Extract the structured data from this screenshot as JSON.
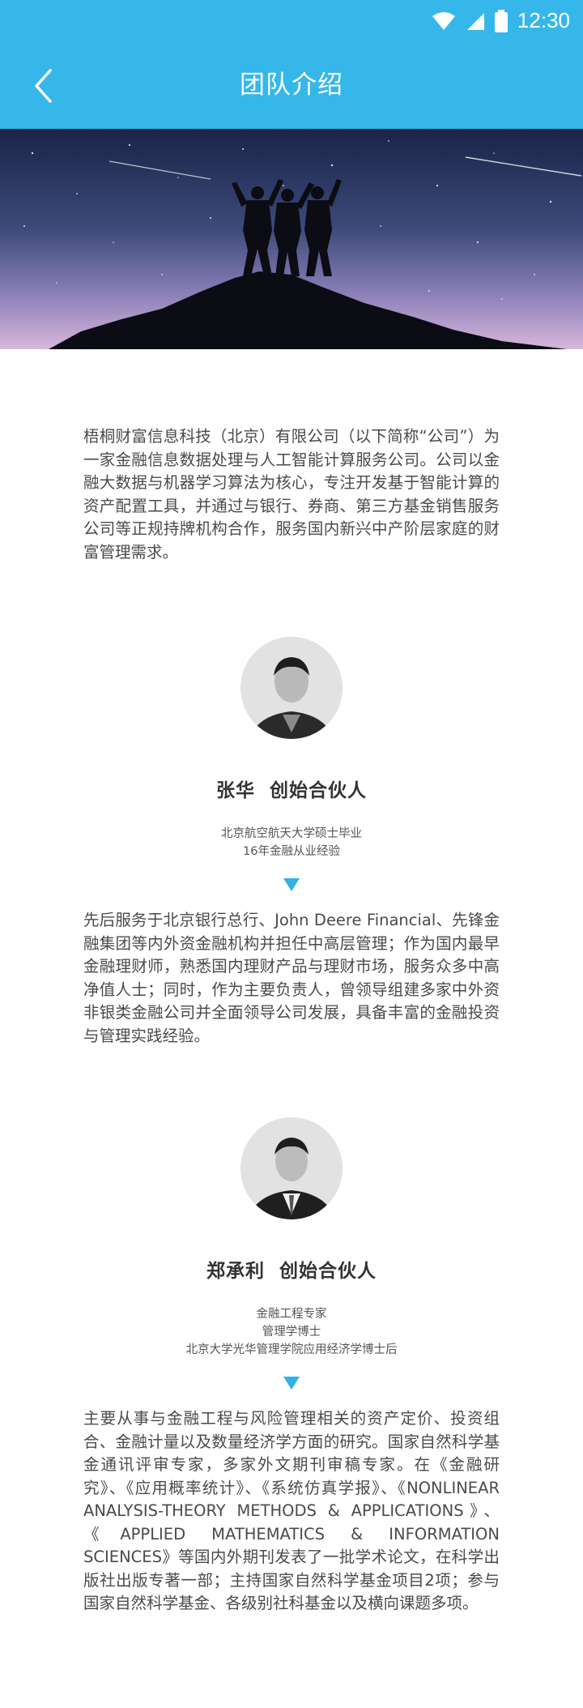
{
  "status": {
    "time": "12:30"
  },
  "appbar": {
    "title": "团队介绍"
  },
  "intro": "梧桐财富信息科技（北京）有限公司（以下简称“公司”）为一家金融信息数据处理与人工智能计算服务公司。公司以金融大数据与机器学习算法为核心，专注开发基于智能计算的资产配置工具，并通过与银行、券商、第三方基金销售服务公司等正规持牌机构合作，服务国内新兴中产阶层家庭的财富管理需求。",
  "members": [
    {
      "name": "张华  创始合伙人",
      "credentials": [
        "北京航空航天大学硕士毕业",
        "16年金融从业经验"
      ],
      "bio": "先后服务于北京银行总行、John Deere Financial、先锋金融集团等内外资金融机构并担任中高层管理；作为国内最早金融理财师，熟悉国内理财产品与理财市场，服务众多中高净值人士；同时，作为主要负责人，曾领导组建多家中外资非银类金融公司并全面领导公司发展，具备丰富的金融投资与管理实践经验。"
    },
    {
      "name": "郑承利  创始合伙人",
      "credentials": [
        "金融工程专家",
        "管理学博士",
        "北京大学光华管理学院应用经济学博士后"
      ],
      "bio": "主要从事与金融工程与风险管理相关的资产定价、投资组合、金融计量以及数量经济学方面的研究。国家自然科学基金通讯评审专家，多家外文期刊审稿专家。在《金融研究》、《应用概率统计》、《系统仿真学报》、《NONLINEAR ANALYSIS-THEORY METHODS & APPLICATIONS》、《APPLIED MATHEMATICS & INFORMATION SCIENCES》等国内外期刊发表了一批学术论文，在科学出版社出版专著一部；主持国家自然科学基金项目2项；参与国家自然科学基金、各级别社科基金以及横向课题多项。"
    }
  ],
  "colors": {
    "accent": "#36b7ea",
    "arrow": "#31b1e6"
  }
}
